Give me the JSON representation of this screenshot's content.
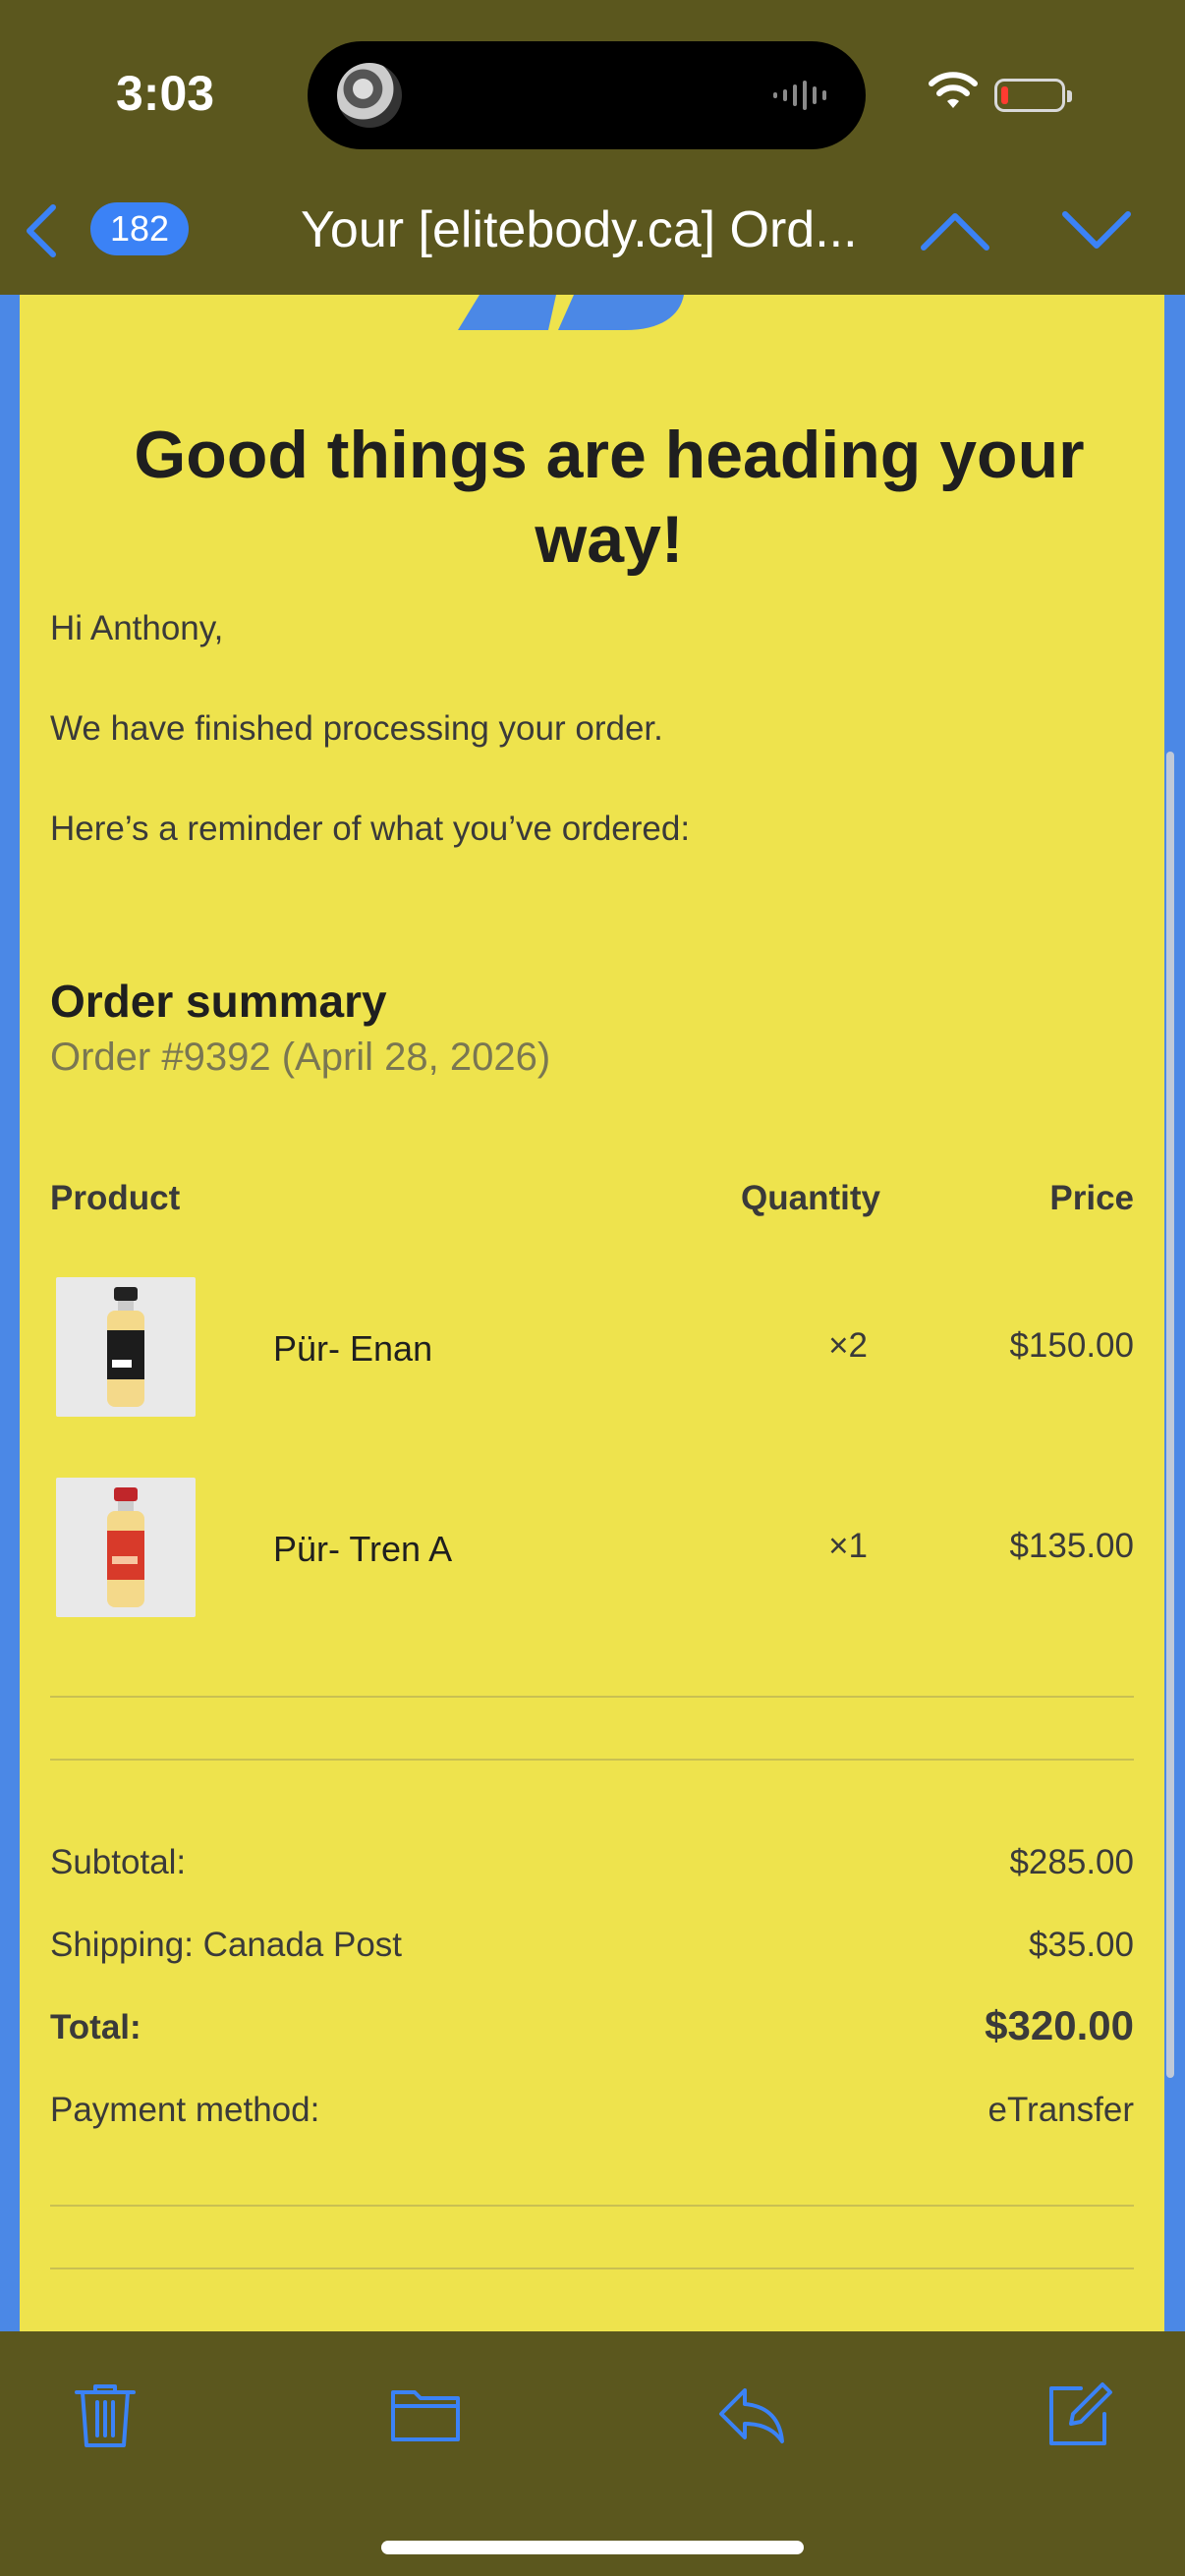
{
  "status_bar": {
    "time": "3:03",
    "icons": [
      "dynamic-island-thumbnail",
      "audio-waveform-icon",
      "wifi-icon",
      "battery-low-icon"
    ]
  },
  "nav": {
    "unread_count": "182",
    "subject": "Your [elitebody.ca] Ord...",
    "icons": [
      "back-chevron-icon",
      "previous-message-icon",
      "next-message-icon"
    ]
  },
  "email": {
    "headline": "Good things are heading your way!",
    "greeting": "Hi Anthony,",
    "body1": "We have finished processing your order.",
    "body2": "Here’s a reminder of what you’ve ordered:",
    "order_summary_title": "Order summary",
    "order_number": "Order #9392 (April 28, 2026)",
    "table": {
      "headers": {
        "product": "Product",
        "quantity": "Quantity",
        "price": "Price"
      },
      "rows": [
        {
          "name": "Pür- Enan",
          "qty": "×2",
          "price": "$150.00"
        },
        {
          "name": "Pür- Tren A",
          "qty": "×1",
          "price": "$135.00"
        }
      ]
    },
    "totals": {
      "subtotal_label": "Subtotal:",
      "subtotal": "$285.00",
      "shipping_label": "Shipping: Canada Post",
      "shipping": "$35.00",
      "total_label": "Total:",
      "total": "$320.00",
      "payment_label": "Payment method:",
      "payment": "eTransfer"
    }
  },
  "toolbar": {
    "icons": [
      "trash-icon",
      "folder-icon",
      "reply-icon",
      "compose-icon"
    ]
  },
  "colors": {
    "accent": "#3b82f6",
    "email_background": "#eee34d",
    "chrome_background": "#5b571e"
  }
}
